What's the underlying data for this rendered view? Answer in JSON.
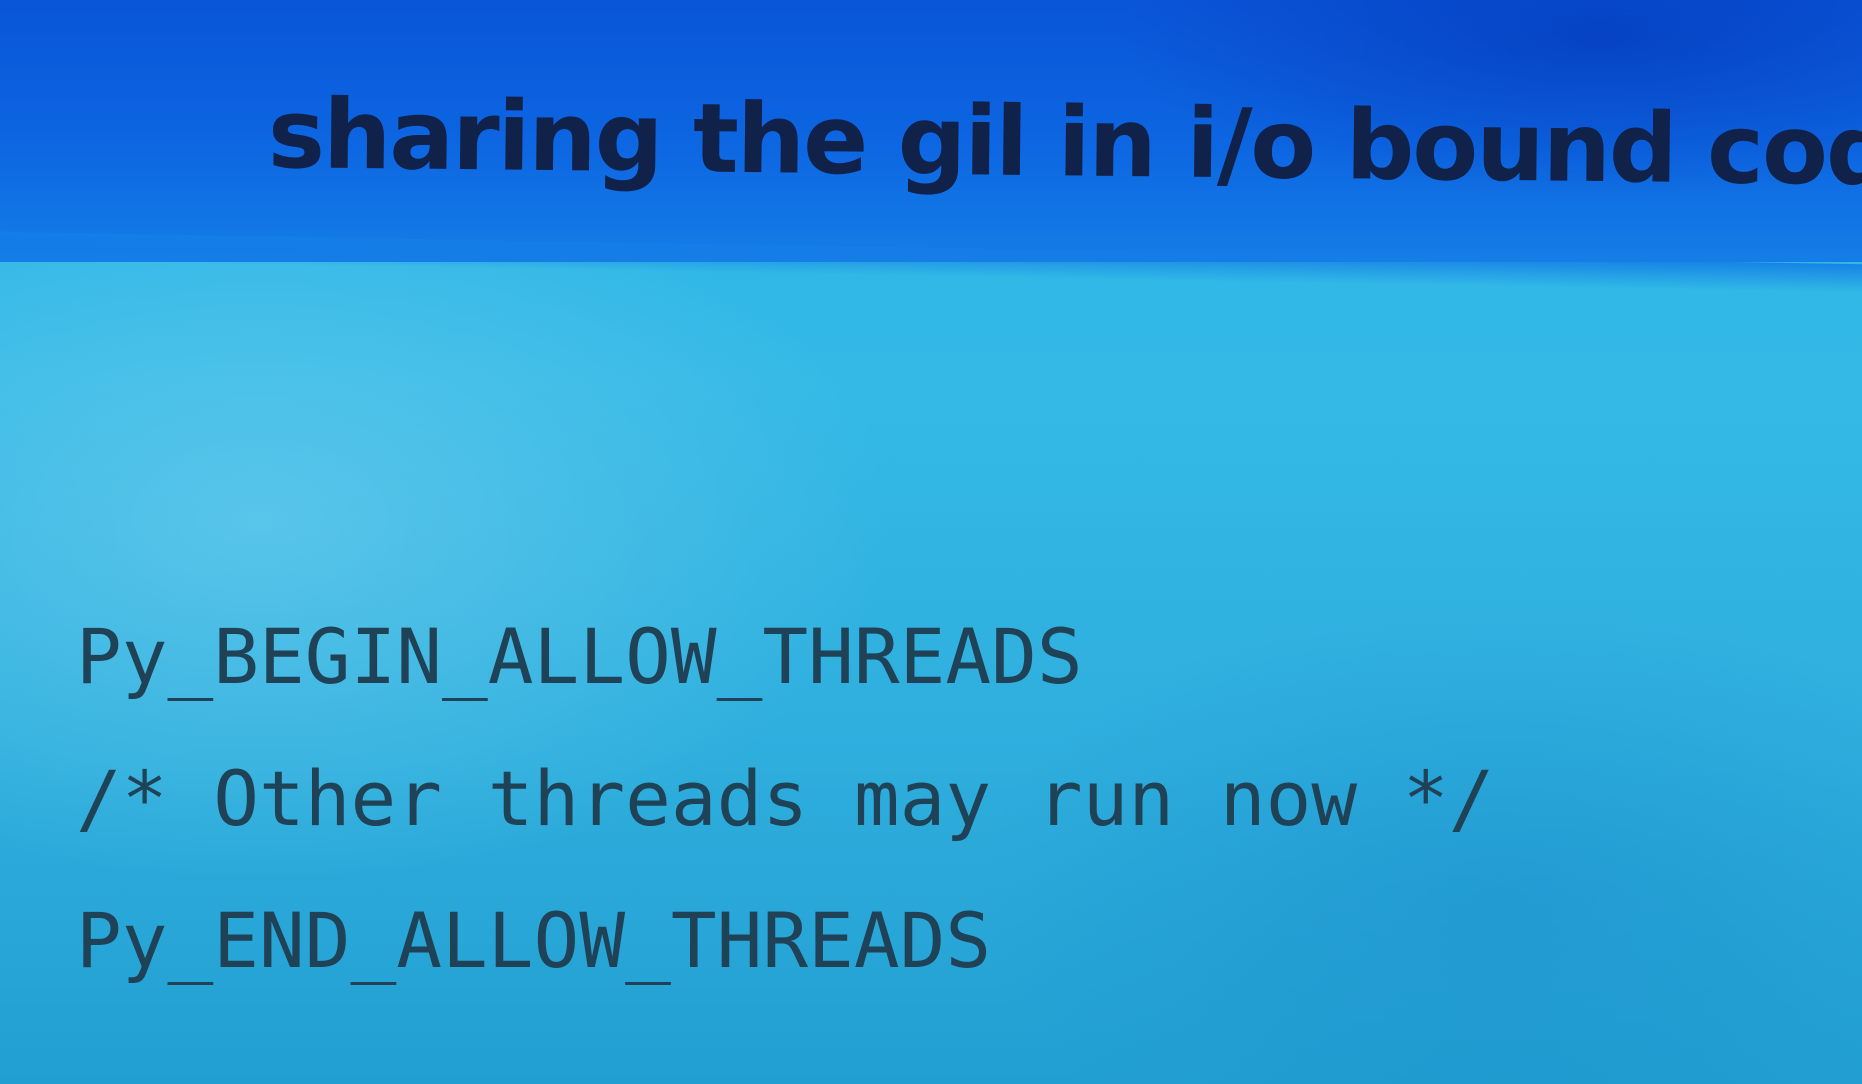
{
  "slide": {
    "title": "sharing the gil in i/o bound code",
    "code_lines": [
      "Py_BEGIN_ALLOW_THREADS",
      "/* Other threads may run now */",
      "Py_END_ALLOW_THREADS"
    ]
  },
  "colors": {
    "title_band": "#0d66e2",
    "body_background": "#31b6e4",
    "title_text": "#10214a",
    "code_text": "#1f4257"
  }
}
